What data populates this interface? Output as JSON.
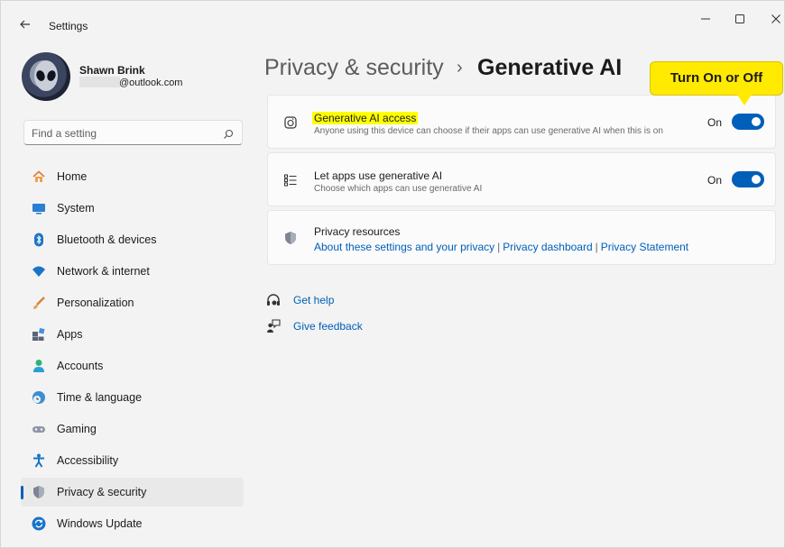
{
  "window": {
    "app_title": "Settings"
  },
  "user": {
    "name": "Shawn Brink",
    "email_suffix": "@outlook.com"
  },
  "search": {
    "placeholder": "Find a setting"
  },
  "sidebar": {
    "items": [
      {
        "label": "Home",
        "icon": "home-icon",
        "selected": false
      },
      {
        "label": "System",
        "icon": "system-icon",
        "selected": false
      },
      {
        "label": "Bluetooth & devices",
        "icon": "bluetooth-icon",
        "selected": false
      },
      {
        "label": "Network & internet",
        "icon": "wifi-icon",
        "selected": false
      },
      {
        "label": "Personalization",
        "icon": "brush-icon",
        "selected": false
      },
      {
        "label": "Apps",
        "icon": "apps-icon",
        "selected": false
      },
      {
        "label": "Accounts",
        "icon": "person-icon",
        "selected": false
      },
      {
        "label": "Time & language",
        "icon": "globe-clock-icon",
        "selected": false
      },
      {
        "label": "Gaming",
        "icon": "gamepad-icon",
        "selected": false
      },
      {
        "label": "Accessibility",
        "icon": "accessibility-icon",
        "selected": false
      },
      {
        "label": "Privacy & security",
        "icon": "shield-icon",
        "selected": true
      },
      {
        "label": "Windows Update",
        "icon": "update-icon",
        "selected": false
      }
    ]
  },
  "header": {
    "parent": "Privacy & security",
    "separator": "›",
    "current": "Generative AI"
  },
  "callout": {
    "text": "Turn On or Off"
  },
  "cards": {
    "gen_ai_access": {
      "title": "Generative AI access",
      "subtitle": "Anyone using this device can choose if their apps can use generative AI when this is on",
      "toggle_label": "On",
      "toggle_on": true
    },
    "let_apps": {
      "title": "Let apps use generative AI",
      "subtitle": "Choose which apps can use generative AI",
      "toggle_label": "On",
      "toggle_on": true
    },
    "privacy_resources": {
      "title": "Privacy resources",
      "links": [
        "About these settings and your privacy",
        "Privacy dashboard",
        "Privacy Statement"
      ],
      "separator": "|"
    }
  },
  "help": {
    "get_help": "Get help",
    "give_feedback": "Give feedback"
  },
  "colors": {
    "accent": "#005fb8",
    "highlight": "#ffff00",
    "callout": "#ffea00"
  }
}
